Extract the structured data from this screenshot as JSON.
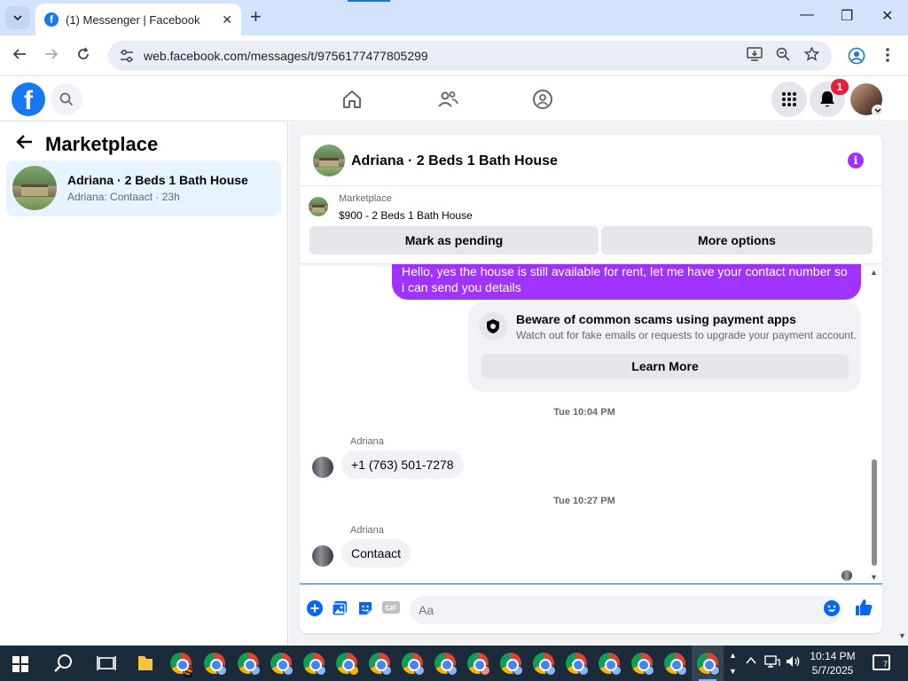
{
  "browser": {
    "tab_title": "(1) Messenger | Facebook",
    "tab_close": "✕",
    "new_tab": "+",
    "url": "web.facebook.com/messages/t/9756177477805299",
    "window_controls": {
      "minimize": "—",
      "restore": "❐",
      "close": "✕"
    }
  },
  "fb_header": {
    "logo": "f",
    "notification_count": "1"
  },
  "left_panel": {
    "title": "Marketplace",
    "conversation": {
      "name": "Adriana · 2 Beds 1 Bath House",
      "preview": "Adriana: Contaact · 23h"
    }
  },
  "chat": {
    "header_name": "Adriana · 2 Beds 1 Bath House",
    "info_icon": "i",
    "listing": {
      "source": "Marketplace",
      "price_title": "$900 - 2 Beds 1 Bath House",
      "mark_pending": "Mark as pending",
      "more_options": "More options"
    },
    "outgoing_message": "Hello, yes the house is still available for rent, let me have your contact number so i can send you  details",
    "scam_warning": {
      "title": "Beware of common scams using payment apps",
      "description": "Watch out for fake emails or requests to upgrade your payment account.",
      "button": "Learn More"
    },
    "timestamp_1": "Tue 10:04 PM",
    "message_1": {
      "sender": "Adriana",
      "text": "+1 (763) 501-7278"
    },
    "timestamp_2": "Tue 10:27 PM",
    "message_2": {
      "sender": "Adriana",
      "text": "Contaact"
    },
    "composer": {
      "placeholder": "Aa",
      "gif_label": "GIF"
    }
  },
  "taskbar": {
    "clock_time": "10:14 PM",
    "clock_date": "5/7/2025",
    "notification_count": "7",
    "badge_s": "S"
  },
  "colors": {
    "fb_blue": "#1877f2",
    "messenger_purple": "#a033ff",
    "selected_item_bg": "#e7f3ff",
    "notification_red": "#e41e3f",
    "taskbar_bg": "#1b2b3a"
  },
  "icons": [
    "facebook-logo-icon",
    "search-icon",
    "home-icon",
    "friends-icon",
    "groups-icon",
    "menu-grid-icon",
    "bell-icon",
    "back-arrow-icon",
    "info-icon",
    "shield-icon",
    "plus-circle-icon",
    "photo-icon",
    "sticker-icon",
    "gif-icon",
    "emoji-icon",
    "thumbs-up-icon",
    "windows-start-icon",
    "chrome-icon"
  ]
}
